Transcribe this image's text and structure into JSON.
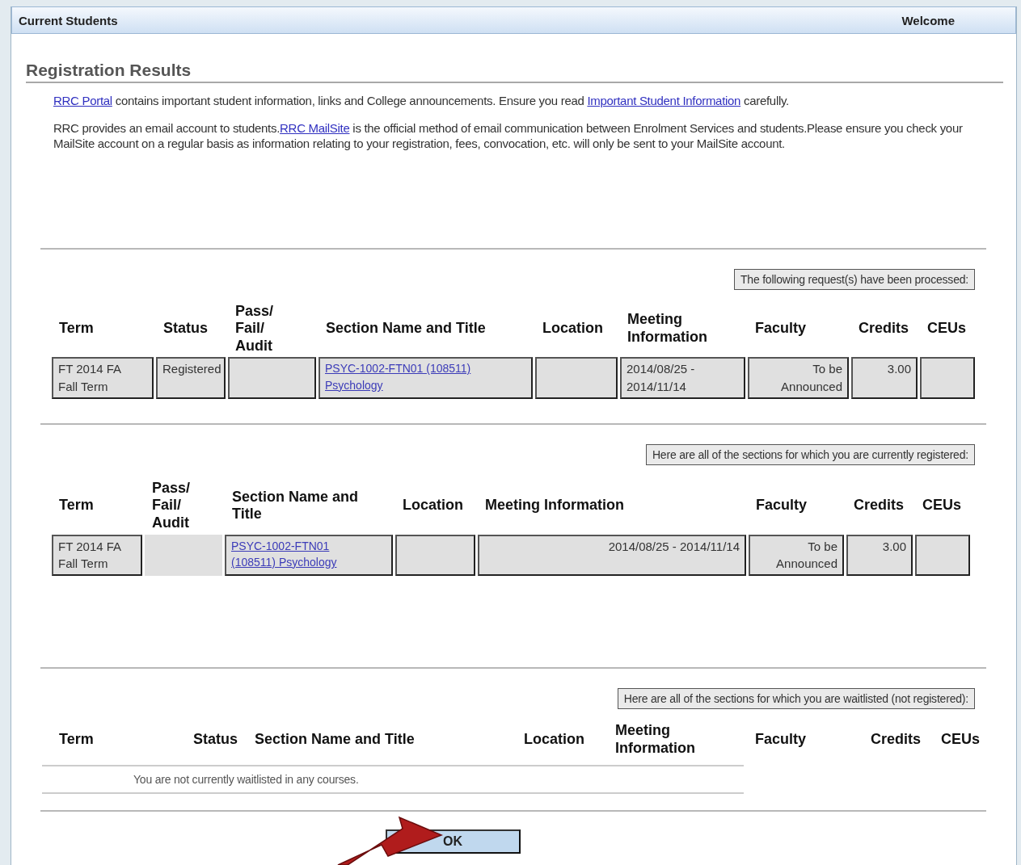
{
  "header": {
    "title": "Current Students",
    "welcome": "Welcome"
  },
  "page_title": "Registration Results",
  "intro": [
    [
      {
        "kind": "link",
        "text": "RRC Portal"
      },
      {
        "kind": "text",
        "text": " contains important student information, links and College announcements. Ensure you read "
      },
      {
        "kind": "link",
        "text": "Important Student Information"
      },
      {
        "kind": "text",
        "text": " carefully."
      }
    ],
    [
      {
        "kind": "text",
        "text": "RRC provides an email account to students."
      },
      {
        "kind": "link",
        "text": "RRC MailSite"
      },
      {
        "kind": "text",
        "text": " is the official method of email communication between Enrolment Services and students.Please ensure you check your MailSite account on a regular basis as information relating to your registration, fees, convocation, etc. will only be sent to your MailSite account."
      }
    ]
  ],
  "sections": [
    {
      "caption": "The following request(s) have been processed:",
      "columns": [
        "Term",
        "Status",
        "Pass/\nFail/\nAudit",
        "Section Name and Title",
        "Location",
        "Meeting\nInformation",
        "Faculty",
        "Credits",
        "CEUs"
      ],
      "rows": [
        {
          "cells": [
            {
              "kind": "text",
              "text": "FT 2014 FA\nFall Term"
            },
            {
              "kind": "text",
              "text": "Registered"
            },
            {
              "kind": "empty"
            },
            {
              "kind": "link",
              "text": "PSYC-1002-FTN01 (108511)\nPsychology"
            },
            {
              "kind": "empty"
            },
            {
              "kind": "text",
              "text": "2014/08/25 -\n2014/11/14"
            },
            {
              "kind": "text",
              "text": "To be\nAnnounced"
            },
            {
              "kind": "text",
              "text": "3.00"
            },
            {
              "kind": "empty"
            }
          ]
        }
      ]
    },
    {
      "caption": "Here are all of the sections for which you are currently registered:",
      "columns": [
        "Term",
        "Pass/\nFail/\nAudit",
        "Section Name and\nTitle",
        "Location",
        "Meeting Information",
        "Faculty",
        "Credits",
        "CEUs"
      ],
      "rows": [
        {
          "cells": [
            {
              "kind": "text",
              "text": "FT 2014 FA\nFall Term"
            },
            {
              "kind": "plain"
            },
            {
              "kind": "link",
              "text": "PSYC-1002-FTN01\n(108511) Psychology"
            },
            {
              "kind": "empty"
            },
            {
              "kind": "text",
              "text": "2014/08/25 - 2014/11/14"
            },
            {
              "kind": "text",
              "text": "To be\nAnnounced"
            },
            {
              "kind": "text",
              "text": "3.00"
            },
            {
              "kind": "empty"
            }
          ]
        }
      ]
    },
    {
      "caption": "Here are all of the sections for which you are waitlisted (not registered):",
      "columns": [
        "Term",
        "Status",
        "Section Name and Title",
        "Location",
        "Meeting\nInformation",
        "Faculty",
        "Credits",
        "CEUs"
      ],
      "empty_message": "You are not currently waitlisted in any courses."
    }
  ],
  "ok_button": "OK"
}
